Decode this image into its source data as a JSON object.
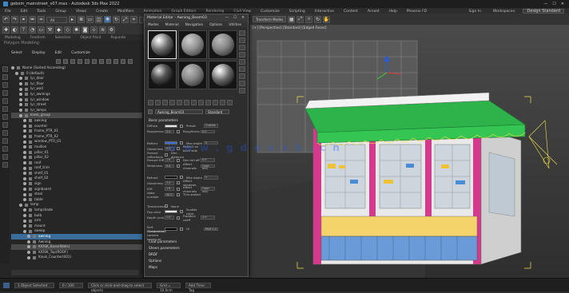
{
  "window": {
    "title": "gebom_mainstreet_v07.max - Autodesk 3ds Max 2022",
    "minimize": "—",
    "maximize": "☐",
    "close": "✕"
  },
  "menubar": {
    "items": [
      "File",
      "Edit",
      "Tools",
      "Group",
      "Views",
      "Create",
      "Modifiers",
      "Animation",
      "Graph Editors",
      "Rendering",
      "Civil View",
      "Customize",
      "Scripting",
      "Interactive",
      "Content",
      "Arnold",
      "Help",
      "Phoenix FD"
    ],
    "workspace_label": "Workspaces:",
    "workspace_value": "Design Standard",
    "user": "Sign In"
  },
  "toolbar": {
    "selection_filter": "All",
    "view_mode": "View",
    "named_selection": "Create Selection Se",
    "layer_field": "Transform Modes"
  },
  "ribbon": {
    "tabs": [
      "Modeling",
      "Freeform",
      "Selection",
      "Object Paint",
      "Populate"
    ],
    "sub_label": "Polygon Modeling"
  },
  "scene_explorer": {
    "tabs": [
      "Select",
      "Display",
      "Edit",
      "Customize"
    ],
    "rows": [
      {
        "name": "Name (Sorted Ascending)",
        "depth": 0,
        "state": "normal"
      },
      {
        "name": "0 (default)",
        "depth": 1,
        "state": "normal"
      },
      {
        "name": "lyr_door",
        "depth": 2,
        "state": "normal"
      },
      {
        "name": "lyr_floor",
        "depth": 2,
        "state": "normal"
      },
      {
        "name": "lyr_wall",
        "depth": 2,
        "state": "normal"
      },
      {
        "name": "lyr_awnings",
        "depth": 2,
        "state": "normal"
      },
      {
        "name": "lyr_window",
        "depth": 2,
        "state": "normal"
      },
      {
        "name": "lyr_street",
        "depth": 2,
        "state": "normal"
      },
      {
        "name": "lyr_lamps",
        "depth": 2,
        "state": "normal"
      },
      {
        "name": "kiosk_group",
        "depth": 2,
        "state": "hi"
      },
      {
        "name": "awning",
        "depth": 3,
        "state": "normal"
      },
      {
        "name": "counter",
        "depth": 3,
        "state": "normal"
      },
      {
        "name": "frame_PTR_01",
        "depth": 3,
        "state": "normal"
      },
      {
        "name": "frame_PTR_02",
        "depth": 3,
        "state": "normal"
      },
      {
        "name": "window_PTR_01",
        "depth": 3,
        "state": "normal"
      },
      {
        "name": "mullion",
        "depth": 3,
        "state": "normal"
      },
      {
        "name": "pillar_01",
        "depth": 3,
        "state": "normal"
      },
      {
        "name": "pillar_02",
        "depth": 3,
        "state": "normal"
      },
      {
        "name": "roof",
        "depth": 3,
        "state": "normal"
      },
      {
        "name": "roof_trim",
        "depth": 3,
        "state": "normal"
      },
      {
        "name": "shelf_01",
        "depth": 3,
        "state": "normal"
      },
      {
        "name": "shelf_02",
        "depth": 3,
        "state": "normal"
      },
      {
        "name": "sign",
        "depth": 3,
        "state": "normal"
      },
      {
        "name": "signboard",
        "depth": 3,
        "state": "normal"
      },
      {
        "name": "stool",
        "depth": 3,
        "state": "normal"
      },
      {
        "name": "table",
        "depth": 3,
        "state": "normal"
      },
      {
        "name": "lamp",
        "depth": 2,
        "state": "normal"
      },
      {
        "name": "lampshade",
        "depth": 3,
        "state": "normal"
      },
      {
        "name": "bulb",
        "depth": 3,
        "state": "normal"
      },
      {
        "name": "arm",
        "depth": 3,
        "state": "normal"
      },
      {
        "name": "mount",
        "depth": 3,
        "state": "normal"
      },
      {
        "name": "sweep",
        "depth": 3,
        "state": "normal"
      },
      {
        "name": "awning",
        "depth": 4,
        "state": "sel"
      },
      {
        "name": "Awning",
        "depth": 4,
        "state": "normal"
      },
      {
        "name": "KIOSK_Base(Walls)",
        "depth": 4,
        "state": "hi"
      },
      {
        "name": "KIOSK_Top(ROOF)",
        "depth": 4,
        "state": "normal"
      },
      {
        "name": "Kiosk_Counter(001)",
        "depth": 4,
        "state": "normal"
      }
    ]
  },
  "material_editor": {
    "title": "Material Editor - Awning_Beam03",
    "menu": [
      "Modes",
      "Material",
      "Navigation",
      "Options",
      "Utilities"
    ],
    "slots": [
      "chrome",
      "texture",
      "matte",
      "dark",
      "matte",
      "chrome"
    ],
    "name": "Awning_Beam03",
    "type": "Standard",
    "rollouts": [
      "Basic parameters",
      "Fresnel",
      "Glossiness",
      "Refraction"
    ],
    "params": [
      {
        "l1": "Diffuse",
        "c1": "#e6e6e6",
        "n1": "",
        "l2": "Preset",
        "v2": "Custom"
      },
      {
        "l1": "Roughness",
        "c1": "",
        "n1": "0.0",
        "l2": "Roughness",
        "v2": "0.0"
      },
      {
        "l1": "",
        "c1": "",
        "n1": "",
        "l2": "",
        "v2": ""
      },
      {
        "l1": "Reflect",
        "c1": "#3a6dd6",
        "n1": "",
        "l2": "Max depth",
        "v2": "5"
      },
      {
        "l1": "Glossiness",
        "c1": "",
        "n1": "0.8",
        "l2": "Reflect on back side",
        "v2": ""
      },
      {
        "l1": "Fresnel reflections",
        "c1": "",
        "n1": "",
        "l2": "Dim distance",
        "v2": ""
      },
      {
        "l1": "Fresnel IOR",
        "c1": "",
        "n1": "1.6",
        "l2": "Dim fall off",
        "v2": "0.0"
      },
      {
        "l1": "Metalness",
        "c1": "",
        "n1": "0.0",
        "l2": "Affect channels",
        "v2": "Color only"
      },
      {
        "l1": "",
        "c1": "",
        "n1": "",
        "l2": "",
        "v2": ""
      },
      {
        "l1": "Refract",
        "c1": "#111111",
        "n1": "",
        "l2": "Max depth",
        "v2": "5"
      },
      {
        "l1": "Glossiness",
        "c1": "",
        "n1": "1.0",
        "l2": "Affect shadows",
        "v2": ""
      },
      {
        "l1": "IOR",
        "c1": "",
        "n1": "1.6",
        "l2": "Affect channels",
        "v2": "Color only"
      },
      {
        "l1": "Abbe number",
        "c1": "",
        "n1": "50.0",
        "l2": "Thin-walled",
        "v2": ""
      },
      {
        "l1": "",
        "c1": "",
        "n1": "",
        "l2": "",
        "v2": ""
      },
      {
        "l1": "Translucency",
        "c1": "",
        "n1": "",
        "l2": "None",
        "v2": ""
      },
      {
        "l1": "Fog color",
        "c1": "#eeeeee",
        "n1": "",
        "l2": "Scatter color",
        "v2": ""
      },
      {
        "l1": "Depth (cm)",
        "c1": "",
        "n1": "1.0",
        "l2": "Fwd/bck coeff",
        "v2": "1.0"
      },
      {
        "l1": "",
        "c1": "",
        "n1": "",
        "l2": "",
        "v2": ""
      },
      {
        "l1": "Self-illumination",
        "c1": "#000000",
        "n1": "",
        "l2": "GI",
        "v2": "Mult 1.0"
      },
      {
        "l1": "Compensate camera exposure",
        "c1": "",
        "n1": "",
        "l2": "",
        "v2": ""
      }
    ],
    "extra_rollouts": [
      "Coat parameters",
      "Sheen parameters",
      "BRDF",
      "Options",
      "Maps"
    ]
  },
  "viewport": {
    "label": "[+] [Perspective] [Standard] [Edged Faces]",
    "watermark": "www.gdoxxb.cn"
  },
  "statusbar": {
    "selection": "1 Object Selected",
    "frame": "0 / 100",
    "prompt": "Click or click-and-drag to select objects",
    "grid": "Grid = 10.0cm",
    "time": "Add Time Tag"
  }
}
